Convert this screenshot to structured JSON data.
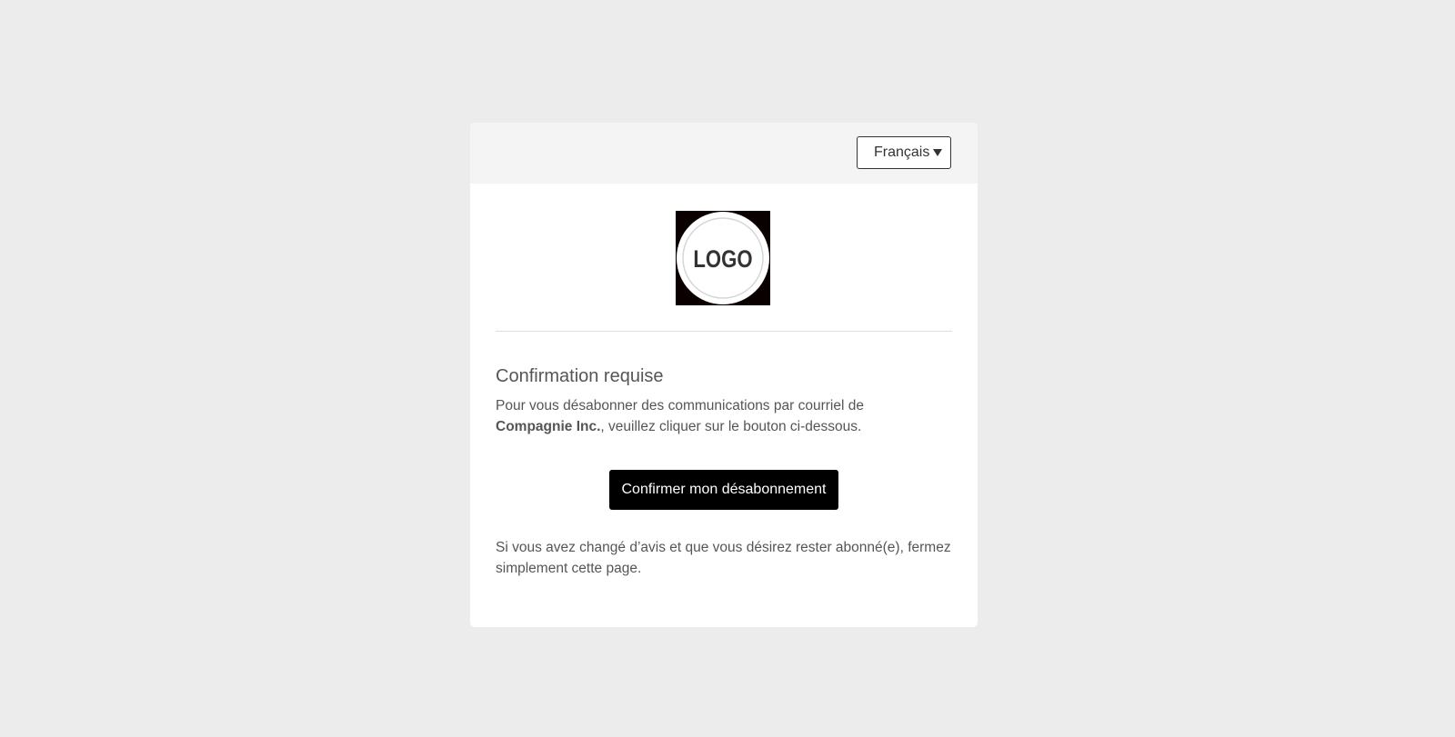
{
  "language_select": {
    "selected": "Français"
  },
  "logo": {
    "text": "LOGO",
    "icon": "logo-icon"
  },
  "content": {
    "title": "Confirmation requise",
    "intro_before": "Pour vous désabonner des communications par courriel de",
    "company": "Compagnie Inc.",
    "intro_after": ", veuillez cliquer sur le bouton ci-dessous.",
    "confirm_button": "Confirmer mon désabonnement",
    "outro": "Si vous avez changé d’avis et que vous désirez rester abonné(e), fermez simplement cette page."
  },
  "colors": {
    "background": "#ececec",
    "card": "#ffffff",
    "header": "#f4f4f4",
    "button": "#000000",
    "text": "#555555"
  }
}
